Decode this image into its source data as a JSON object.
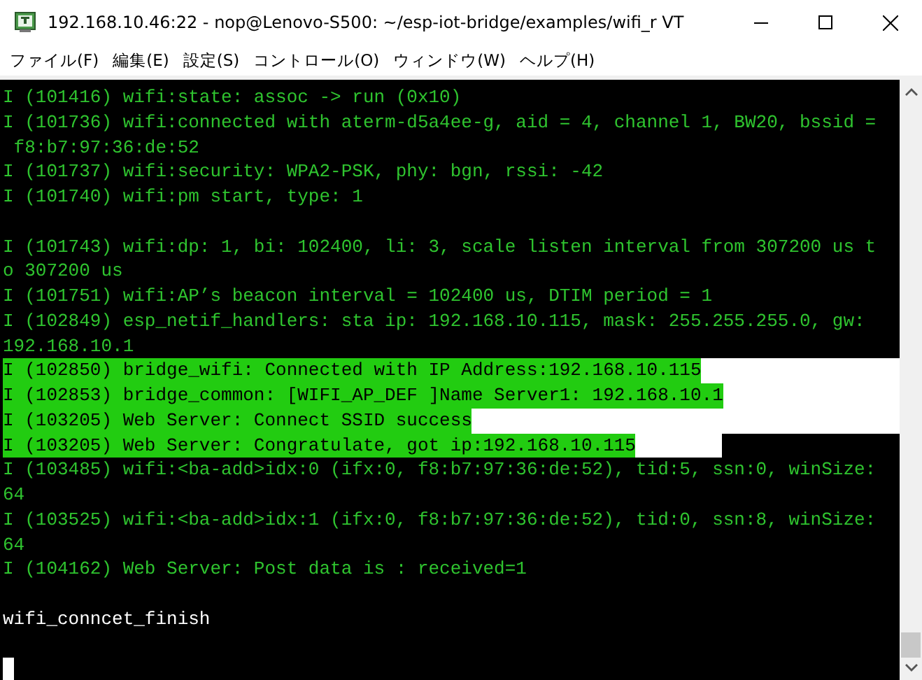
{
  "window": {
    "title": "192.168.10.46:22 - nop@Lenovo-S500: ~/esp-iot-bridge/examples/wifi_r VT"
  },
  "menu": [
    "ファイル(F)",
    "編集(E)",
    "設定(S)",
    "コントロール(O)",
    "ウィンドウ(W)",
    "ヘルプ(H)"
  ],
  "terminal": {
    "lines": [
      {
        "kind": "log",
        "text": "I (101416) wifi:state: assoc -> run (0x10)",
        "selected": false
      },
      {
        "kind": "log",
        "text": "I (101736) wifi:connected with aterm-d5a4ee-g, aid = 4, channel 1, BW20, bssid =",
        "selected": false
      },
      {
        "kind": "log",
        "text": " f8:b7:97:36:de:52",
        "selected": false
      },
      {
        "kind": "log",
        "text": "I (101737) wifi:security: WPA2-PSK, phy: bgn, rssi: -42",
        "selected": false
      },
      {
        "kind": "log",
        "text": "I (101740) wifi:pm start, type: 1",
        "selected": false
      },
      {
        "kind": "blank"
      },
      {
        "kind": "log",
        "text": "I (101743) wifi:dp: 1, bi: 102400, li: 3, scale listen interval from 307200 us t",
        "selected": false
      },
      {
        "kind": "log",
        "text": "o 307200 us",
        "selected": false
      },
      {
        "kind": "log",
        "text": "I (101751) wifi:AP’s beacon interval = 102400 us, DTIM period = 1",
        "selected": false
      },
      {
        "kind": "log",
        "text": "I (102849) esp_netif_handlers: sta ip: 192.168.10.115, mask: 255.255.255.0, gw:",
        "selected": false
      },
      {
        "kind": "log",
        "text": "192.168.10.1",
        "selected": false
      },
      {
        "kind": "log",
        "text": "I (102850) bridge_wifi: Connected with IP Address:192.168.10.115",
        "selected": true
      },
      {
        "kind": "log",
        "text": "I (102853) bridge_common: [WIFI_AP_DEF ]Name Server1: 192.168.10.1",
        "selected": true
      },
      {
        "kind": "log",
        "text": "I (103205) Web Server: Connect SSID success",
        "selected": true
      },
      {
        "kind": "log",
        "text": "I (103205) Web Server: Congratulate, got ip:192.168.10.115",
        "selected": true
      },
      {
        "kind": "log",
        "text": "I (103485) wifi:<ba-add>idx:0 (ifx:0, f8:b7:97:36:de:52), tid:5, ssn:0, winSize:",
        "selected": false
      },
      {
        "kind": "log",
        "text": "64",
        "selected": false
      },
      {
        "kind": "log",
        "text": "I (103525) wifi:<ba-add>idx:1 (ifx:0, f8:b7:97:36:de:52), tid:0, ssn:8, winSize:",
        "selected": false
      },
      {
        "kind": "log",
        "text": "64",
        "selected": false
      },
      {
        "kind": "log",
        "text": "I (104162) Web Server: Post data is : received=1",
        "selected": false
      },
      {
        "kind": "blank"
      },
      {
        "kind": "plain",
        "text": "wifi_conncet_finish"
      },
      {
        "kind": "blank"
      },
      {
        "kind": "cursor"
      }
    ]
  }
}
